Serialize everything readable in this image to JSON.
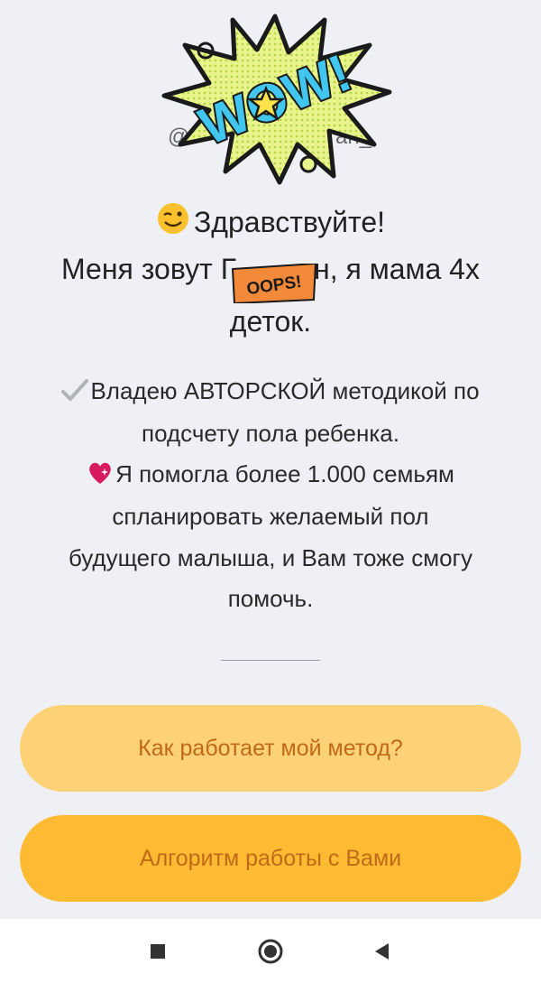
{
  "profile": {
    "handle_start": "@",
    "handle_end": "an_"
  },
  "greeting": {
    "line1": "Здравствуйте!",
    "line2_a": "Меня зовут Г",
    "line2_b": "н, я мама 4х",
    "line3": "деток."
  },
  "sticker": {
    "wow": "WOW!",
    "oops": "OOPS!"
  },
  "about": {
    "line1": "Владею АВТОРСКОЙ методикой по",
    "line2": "подсчету пола ребенка.",
    "line3": "Я помогла более 1.000 семьям",
    "line4": "спланировать желаемый пол",
    "line5": "будущего малыша, и Вам тоже смогу",
    "line6": "помочь."
  },
  "buttons": {
    "method": "Как работает мой метод?",
    "algorithm": "Алгоритм работы с Вами"
  },
  "colors": {
    "button1_bg": "#fdd277",
    "button2_bg": "#fdbb33",
    "button_text": "#c06a17",
    "background": "#eef0f5"
  },
  "icons": {
    "wink": "winking-face-icon",
    "check": "check-mark-icon",
    "heart": "sparkling-heart-icon",
    "nav_recent": "square-icon",
    "nav_home": "circle-icon",
    "nav_back": "triangle-back-icon"
  }
}
